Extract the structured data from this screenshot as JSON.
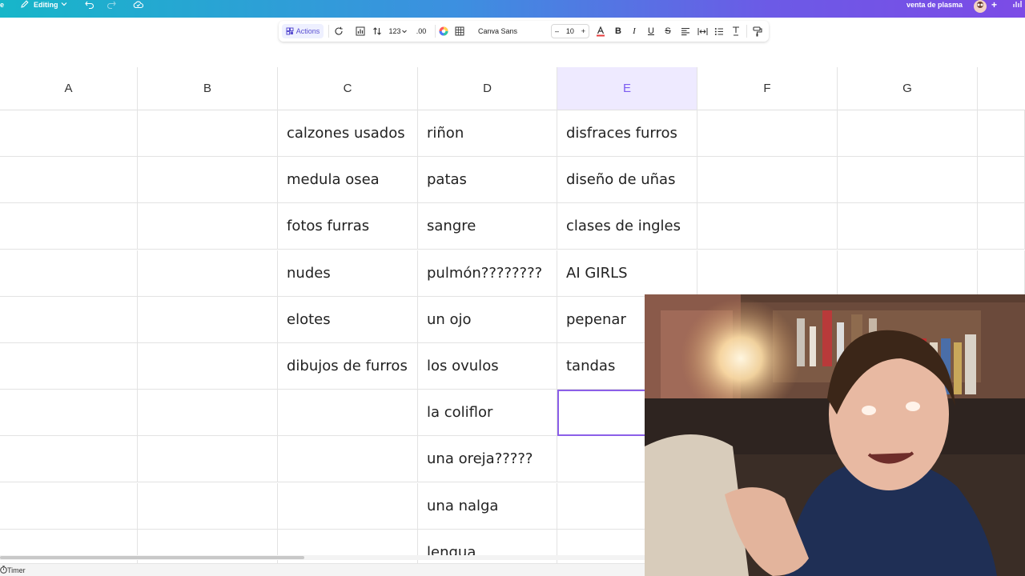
{
  "topbar": {
    "left_fragment": "e",
    "editing_label": "Editing",
    "project_name": "venta de plasma"
  },
  "toolbar": {
    "actions_label": "Actions",
    "number_format": "123",
    "decimal_label": ".00",
    "font_name": "Canva Sans",
    "font_size": "10",
    "minus": "–",
    "plus": "+",
    "bold": "B",
    "italic": "I",
    "underline": "U",
    "strike": "S"
  },
  "sheet": {
    "columns": [
      "A",
      "B",
      "C",
      "D",
      "E",
      "F",
      "G"
    ],
    "selected_column": "E",
    "cells": {
      "C": [
        "calzones usados",
        "medula osea",
        "fotos furras",
        "nudes",
        "elotes",
        "dibujos de furros",
        "",
        "",
        "",
        ""
      ],
      "D": [
        "riñon",
        "patas",
        "sangre",
        "pulmón????????",
        "un ojo",
        "los ovulos",
        "la coliflor",
        "una oreja?????",
        "una nalga",
        "lengua"
      ],
      "E": [
        "disfraces furros",
        "diseño de uñas",
        "clases de ingles",
        "AI GIRLS",
        "pepenar",
        "tandas",
        "",
        "",
        "",
        ""
      ]
    }
  },
  "footer": {
    "timer_label": "Timer"
  },
  "colors": {
    "accent": "#8b5fe8",
    "header_selected_bg": "#eeeaff",
    "topbar_start": "#17b6c9",
    "topbar_end": "#7c4be6"
  }
}
